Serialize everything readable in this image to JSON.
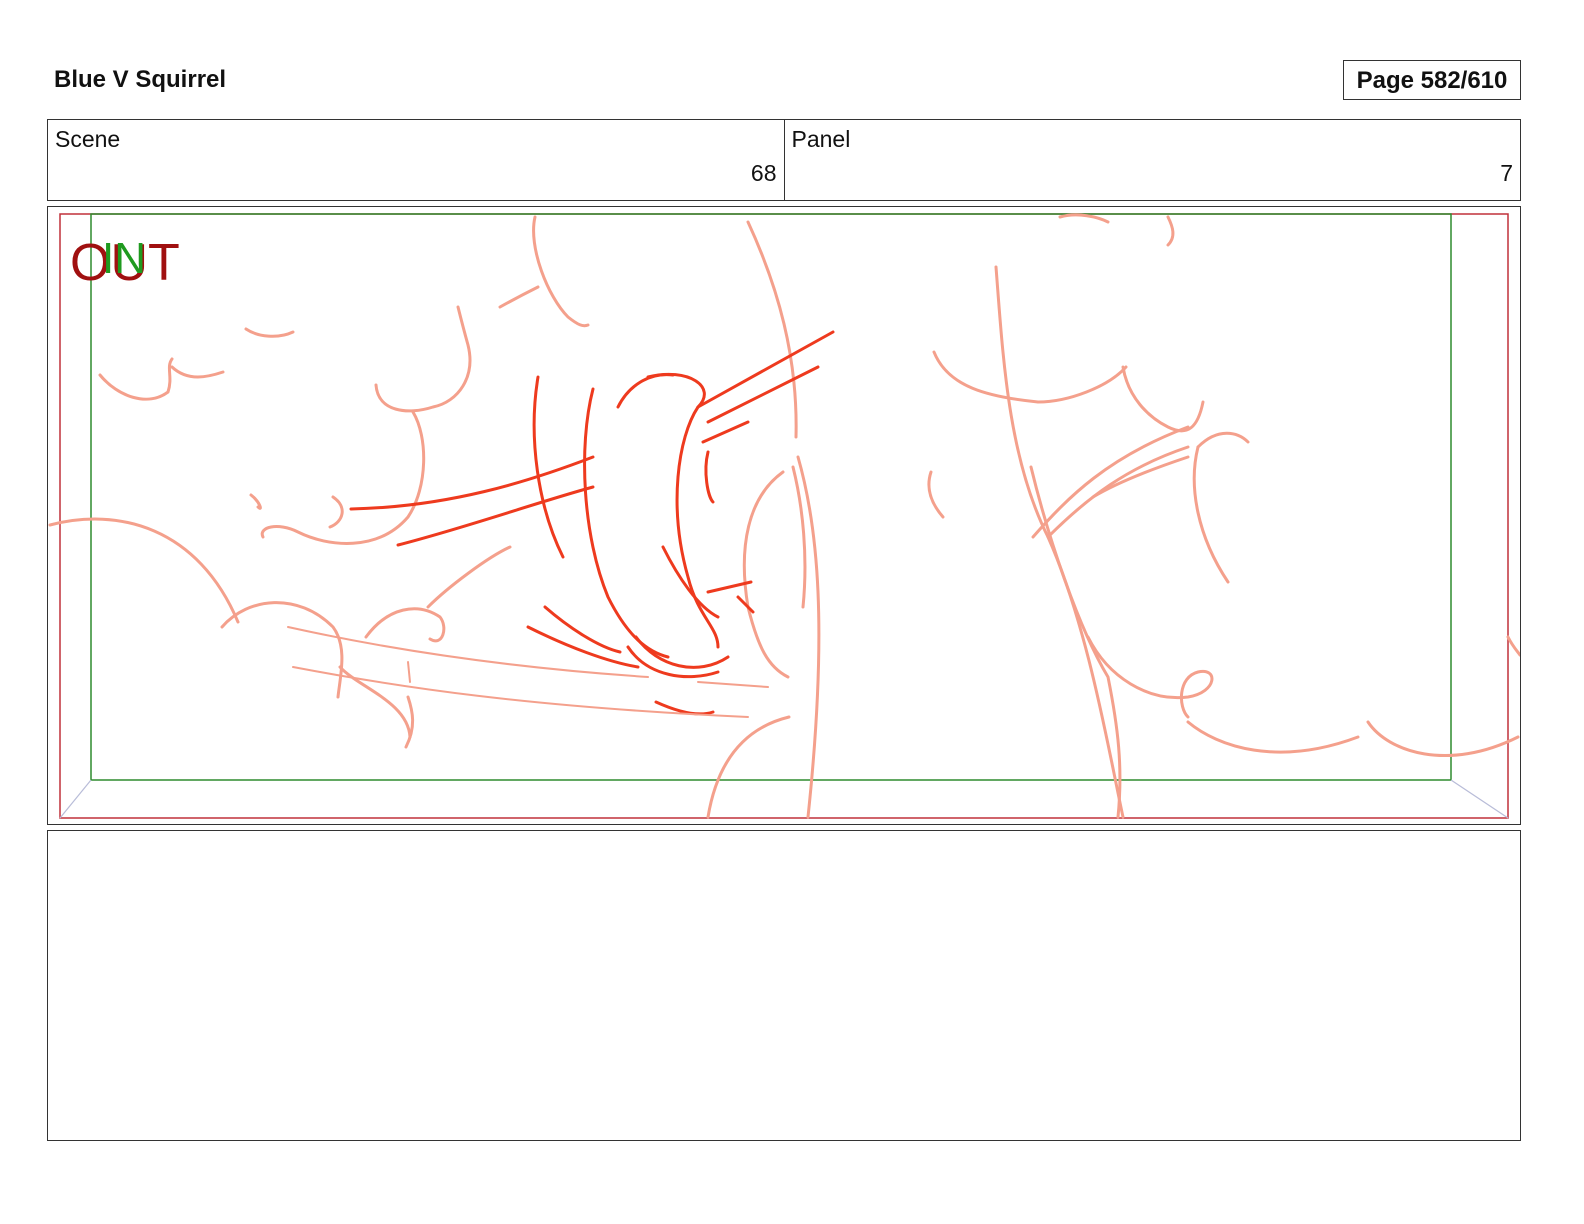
{
  "header": {
    "title": "Blue V Squirrel",
    "page_label": "Page 582/610"
  },
  "scene": {
    "label": "Scene",
    "value": "68"
  },
  "panel": {
    "label": "Panel",
    "value": "7"
  },
  "frame": {
    "in_marker": "IN",
    "out_marker": "OUT",
    "colors": {
      "safe_frame": "#2e8b2e",
      "outer_frame": "#c0303a",
      "sketch_light": "#f4a08c",
      "sketch_bold": "#ee3a1e"
    }
  },
  "notes": {
    "text": ""
  }
}
